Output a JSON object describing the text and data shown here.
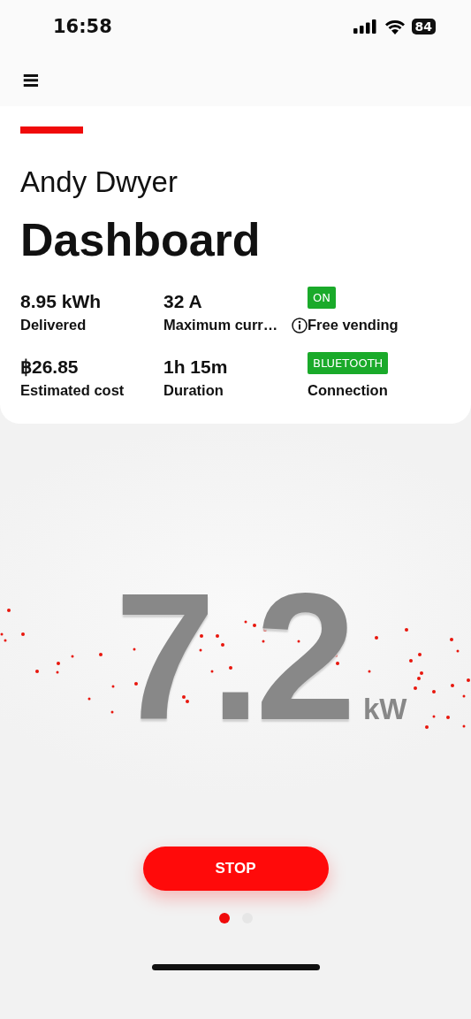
{
  "status_bar": {
    "time": "16:58",
    "battery": "84"
  },
  "header": {
    "menu_icon": "≡"
  },
  "card": {
    "user_name": "Andy Dwyer",
    "title": "Dashboard",
    "stats": [
      {
        "kind": "value",
        "value": "8.95 kWh",
        "label": "Delivered"
      },
      {
        "kind": "value",
        "value": "32 A",
        "label": "Maximum curr…"
      },
      {
        "kind": "badge",
        "value": "ON",
        "label": "Free vending",
        "info": true,
        "color": "#1aaa2a"
      },
      {
        "kind": "value",
        "value": "฿26.85",
        "label": "Estimated cost"
      },
      {
        "kind": "value",
        "value": "1h 15m",
        "label": "Duration"
      },
      {
        "kind": "badge",
        "value": "BLUETOOTH",
        "label": "Connection",
        "info": false,
        "color": "#1aaa2a"
      }
    ]
  },
  "power": {
    "value": "7.2",
    "unit": "kW"
  },
  "stop_button": "STOP",
  "pager": [
    {
      "selected": true
    },
    {
      "selected": false
    }
  ]
}
